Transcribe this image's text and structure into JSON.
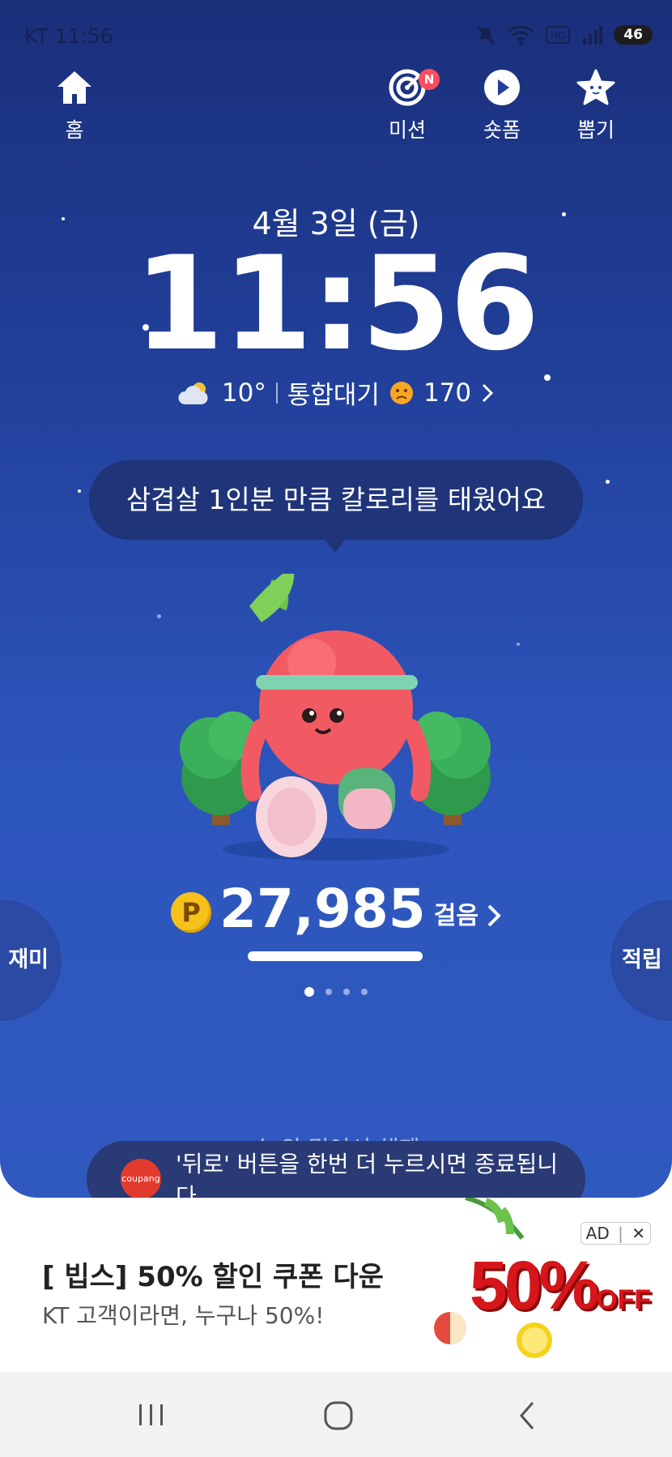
{
  "status_bar": {
    "carrier_time": "KT 11:56",
    "battery": "46"
  },
  "nav": {
    "home": "홈",
    "mission": "미션",
    "mission_badge": "N",
    "shortform": "숏폼",
    "draw": "뽑기"
  },
  "date": "4월 3일 (금)",
  "clock": "11:56",
  "weather": {
    "temp": "10°",
    "air_label": "통합대기",
    "air_value": "170"
  },
  "speech_bubble": "삼겹살 1인분 만큼 칼로리를 태웠어요",
  "steps": {
    "coin": "P",
    "value": "27,985",
    "unit": "걸음"
  },
  "page_dots": {
    "count": 4,
    "active": 0
  },
  "side_buttons": {
    "left": "재미",
    "right": "적립"
  },
  "peek_text": "수 의 믿어서 해제",
  "toast": {
    "icon_text": "coupang",
    "message": "'뒤로' 버튼을 한번 더 누르시면 종료됩니다."
  },
  "ad": {
    "title": "[ 빕스] 50% 할인 쿠폰 다운",
    "subtitle": "KT 고객이라면, 누구나 50%!",
    "tag": "AD",
    "close": "✕",
    "promo_big": "50%",
    "promo_small": "OFF"
  },
  "colors": {
    "sky_top": "#1a2f7a",
    "sky_bottom": "#3059c0",
    "coin": "#f6c21a",
    "promo": "#d6161b"
  }
}
